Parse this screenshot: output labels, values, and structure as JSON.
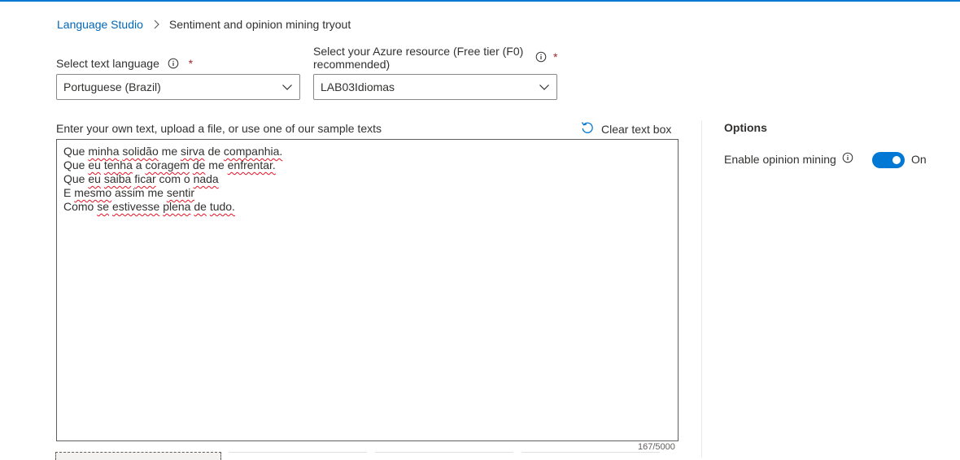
{
  "breadcrumb": {
    "root": "Language Studio",
    "current": "Sentiment and opinion mining tryout"
  },
  "language_field": {
    "label": "Select text language",
    "required_mark": "*",
    "value": "Portuguese (Brazil)"
  },
  "resource_field": {
    "label_line1": "Select your Azure resource (Free tier (F0)",
    "label_line2": "recommended)",
    "required_mark": "*",
    "value": "LAB03Idiomas"
  },
  "input_area": {
    "label": "Enter your own text, upload a file, or use one of our sample texts",
    "clear_label": "Clear text box",
    "lines": [
      "Que minha solidão me sirva de companhia.",
      "Que eu tenha a coragem de me enfrentar.",
      "Que eu saiba ficar com o nada",
      "E mesmo assim me sentir",
      "Como se estivesse plena de tudo."
    ],
    "counter": "167/5000"
  },
  "options": {
    "title": "Options",
    "opinion_mining_label": "Enable opinion mining",
    "toggle_state": "On"
  },
  "colors": {
    "accent": "#0078d4",
    "link": "#0067b8",
    "required": "#a4262c",
    "spellcheck": "#e81123"
  },
  "icons": [
    "chevron-right-icon",
    "info-icon",
    "chevron-down-icon",
    "undo-icon"
  ]
}
